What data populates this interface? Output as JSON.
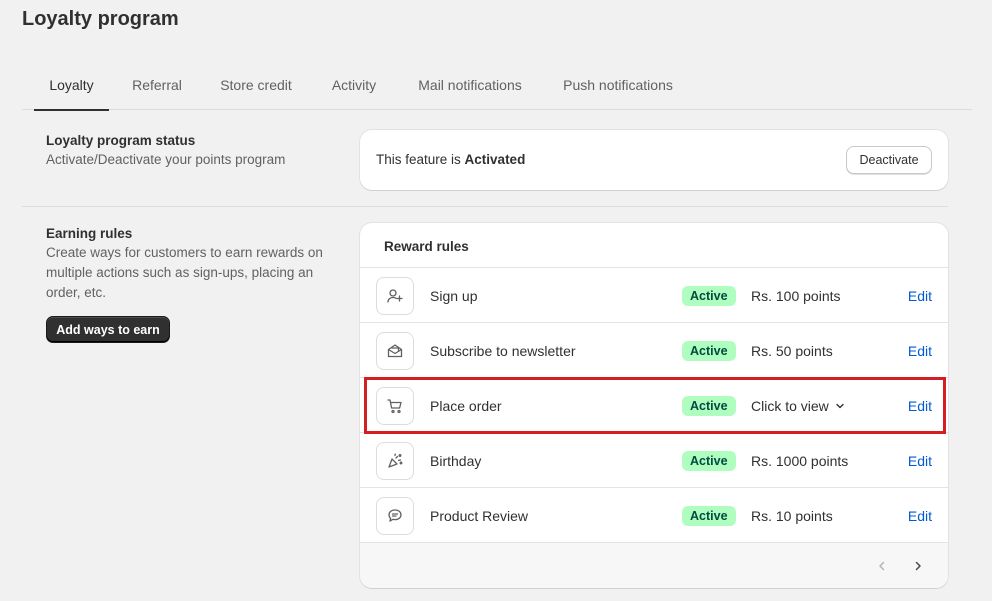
{
  "page": {
    "title": "Loyalty program"
  },
  "tabs": [
    {
      "label": "Loyalty",
      "active": true
    },
    {
      "label": "Referral"
    },
    {
      "label": "Store credit"
    },
    {
      "label": "Activity"
    },
    {
      "label": "Mail notifications"
    },
    {
      "label": "Push notifications"
    }
  ],
  "status_section": {
    "heading": "Loyalty program status",
    "description": "Activate/Deactivate your points program",
    "feature_prefix": "This feature is ",
    "feature_state": "Activated",
    "deactivate_label": "Deactivate"
  },
  "earning_section": {
    "heading": "Earning rules",
    "description": "Create ways for customers to earn rewards on multiple actions such as sign-ups, placing an order, etc.",
    "add_button_label": "Add ways to earn"
  },
  "reward_rules": {
    "title": "Reward rules",
    "rows": [
      {
        "icon": "person-add-icon",
        "name": "Sign up",
        "status": "Active",
        "points": "Rs. 100 points",
        "edit": "Edit"
      },
      {
        "icon": "envelope-icon",
        "name": "Subscribe to newsletter",
        "status": "Active",
        "points": "Rs. 50 points",
        "edit": "Edit"
      },
      {
        "icon": "cart-icon",
        "name": "Place order",
        "status": "Active",
        "points": "Click to view",
        "edit": "Edit"
      },
      {
        "icon": "confetti-icon",
        "name": "Birthday",
        "status": "Active",
        "points": "Rs. 1000 points",
        "edit": "Edit"
      },
      {
        "icon": "chat-icon",
        "name": "Product Review",
        "status": "Active",
        "points": "Rs. 10 points",
        "edit": "Edit"
      }
    ]
  },
  "colors": {
    "badge_bg": "#affebf",
    "badge_text": "#014b40",
    "link": "#005bd3",
    "highlight": "#d21f26"
  }
}
